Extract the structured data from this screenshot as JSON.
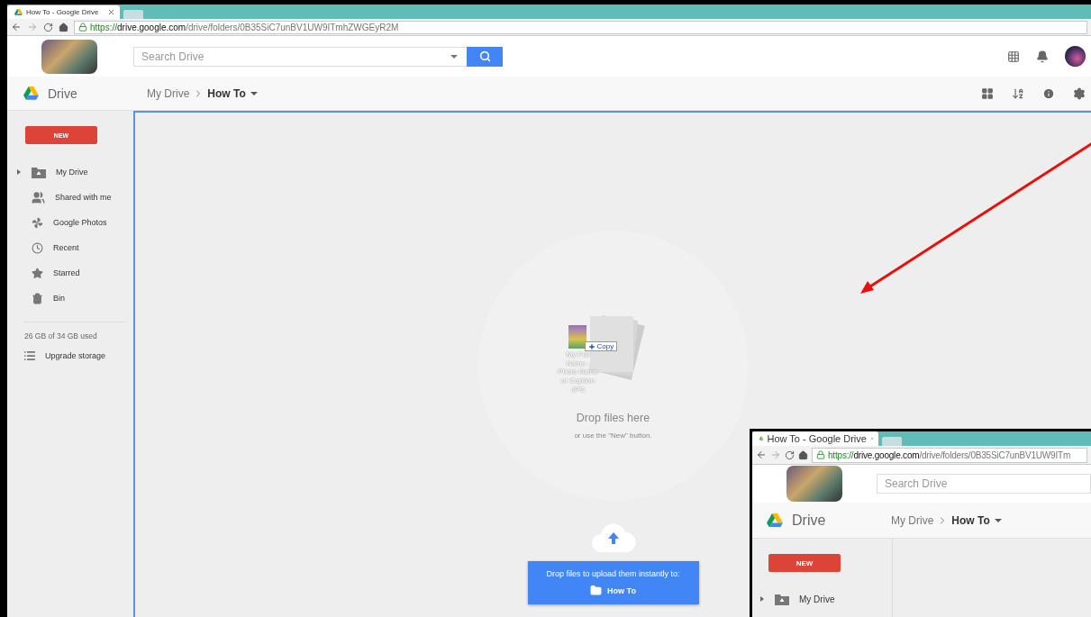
{
  "browser": {
    "tab_title": "How To - Google Drive",
    "url_scheme": "https://",
    "url_host": "drive.google.com",
    "url_path": "/drive/folders/0B35SiC7unBV1UW9ITmhZWGEyR2M"
  },
  "header": {
    "search_placeholder": "Search Drive"
  },
  "toolbar": {
    "app_name": "Drive",
    "breadcrumb": [
      {
        "label": "My Drive",
        "current": false
      },
      {
        "label": "How To",
        "current": true
      }
    ]
  },
  "sidebar": {
    "new_button": "NEW",
    "items": [
      {
        "label": "My Drive",
        "kind": "drive",
        "expanded": false
      },
      {
        "label": "Shared with me",
        "kind": "shared"
      },
      {
        "label": "Google Photos",
        "kind": "photos"
      },
      {
        "label": "Recent",
        "kind": "recent"
      },
      {
        "label": "Starred",
        "kind": "starred"
      },
      {
        "label": "Bin",
        "kind": "bin"
      }
    ],
    "storage": "26 GB of 34 GB used",
    "upgrade": "Upgrade storage"
  },
  "drop_zone": {
    "file_name": "My Full Name - Photo Name or Caption JPG",
    "copy_badge": "Copy",
    "title": "Drop files here",
    "subtitle": "or use the \"New\" button.",
    "banner_text": "Drop files to upload them instantly to:",
    "banner_folder": "How To"
  },
  "inset": {
    "tab_title": "How To - Google Drive",
    "url_scheme": "https://",
    "url_host": "drive.google.com",
    "url_path": "/drive/folders/0B35SiC7unBV1UW9ITm",
    "search_placeholder": "Search Drive",
    "app_name": "Drive",
    "breadcrumb": [
      {
        "label": "My Drive",
        "current": false
      },
      {
        "label": "How To",
        "current": true
      }
    ],
    "new_button": "NEW",
    "items": [
      {
        "label": "My Drive",
        "kind": "drive",
        "expanded": false
      }
    ]
  }
}
